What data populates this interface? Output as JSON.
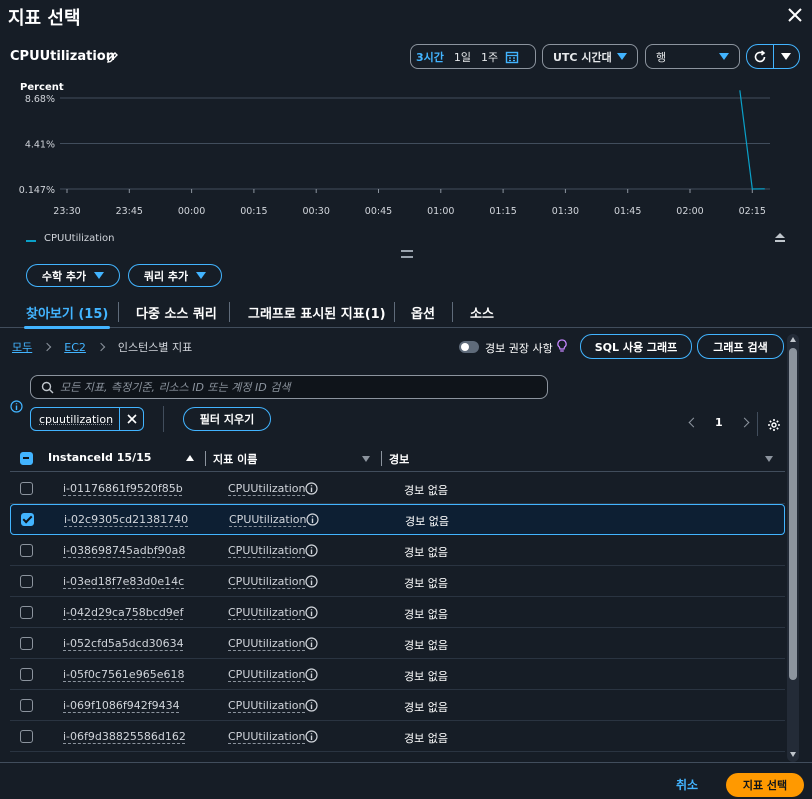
{
  "dialog": {
    "title": "지표 선택"
  },
  "metric": {
    "title": "CPUUtilization"
  },
  "timerange": {
    "options": [
      "3시간",
      "1일",
      "1주"
    ],
    "active": "3시간"
  },
  "timezone": {
    "label": "UTC 시간대"
  },
  "view": {
    "label": "행"
  },
  "chart_data": {
    "type": "line",
    "ylabel": "Percent",
    "ytick_labels": [
      "8.68%",
      "4.41%",
      "0.147%"
    ],
    "y_ticks": [
      8.68,
      4.41,
      0.147
    ],
    "ylim": [
      0.147,
      8.68
    ],
    "x": [
      "23:30",
      "23:45",
      "00:00",
      "00:15",
      "00:30",
      "00:45",
      "01:00",
      "01:15",
      "01:30",
      "01:45",
      "02:00",
      "02:15"
    ],
    "series": [
      {
        "name": "CPUUtilization",
        "points": [
          [
            2.2,
            9.4
          ],
          [
            2.25,
            0.15
          ],
          [
            2.3,
            0.16
          ]
        ],
        "color": "#0aa0c8"
      }
    ],
    "grid": true,
    "legend": "bottom-left"
  },
  "buttons": {
    "math": "수학 추가",
    "query": "쿼리 추가",
    "sql": "SQL 사용 그래프",
    "graph_search": "그래프 검색",
    "clear_filters": "필터 지우기",
    "cancel": "취소",
    "select": "지표 선택"
  },
  "tabs": [
    {
      "label": "찾아보기 (15)"
    },
    {
      "label": "다중 소스 쿼리"
    },
    {
      "label": "그래프로 표시된 지표(1)"
    },
    {
      "label": "옵션"
    },
    {
      "label": "소스"
    }
  ],
  "breadcrumb": {
    "items": [
      "모두",
      "EC2",
      "인스턴스별 지표"
    ]
  },
  "alarm_recommendations": {
    "label": "경보 권장 사항"
  },
  "search": {
    "placeholder": "모든 지표, 측정기준, 리소스 ID 또는 계정 ID 검색"
  },
  "filter_token": {
    "label": "cpuutilization"
  },
  "pager": {
    "page": "1"
  },
  "table": {
    "columns": [
      "InstanceId 15/15",
      "지표 이름",
      "경보"
    ],
    "rows": [
      {
        "id": "i-01176861f9520f85b",
        "metric": "CPUUtilization",
        "alarm": "경보 없음",
        "checked": false
      },
      {
        "id": "i-02c9305cd21381740",
        "metric": "CPUUtilization",
        "alarm": "경보 없음",
        "checked": true
      },
      {
        "id": "i-038698745adbf90a8",
        "metric": "CPUUtilization",
        "alarm": "경보 없음",
        "checked": false
      },
      {
        "id": "i-03ed18f7e83d0e14c",
        "metric": "CPUUtilization",
        "alarm": "경보 없음",
        "checked": false
      },
      {
        "id": "i-042d29ca758bcd9ef",
        "metric": "CPUUtilization",
        "alarm": "경보 없음",
        "checked": false
      },
      {
        "id": "i-052cfd5a5dcd30634",
        "metric": "CPUUtilization",
        "alarm": "경보 없음",
        "checked": false
      },
      {
        "id": "i-05f0c7561e965e618",
        "metric": "CPUUtilization",
        "alarm": "경보 없음",
        "checked": false
      },
      {
        "id": "i-069f1086f942f9434",
        "metric": "CPUUtilization",
        "alarm": "경보 없음",
        "checked": false
      },
      {
        "id": "i-06f9d38825586d162",
        "metric": "CPUUtilization",
        "alarm": "경보 없음",
        "checked": false
      }
    ]
  }
}
